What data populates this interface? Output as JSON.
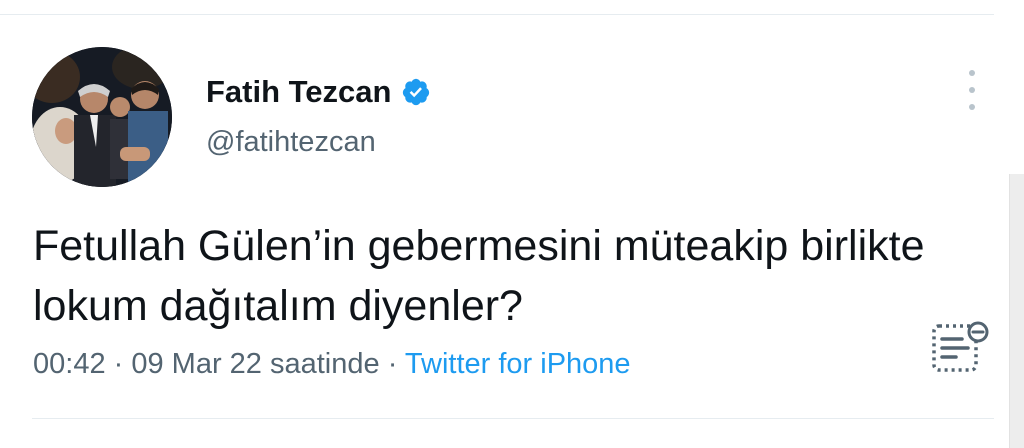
{
  "tweet": {
    "author_name": "Fatih Tezcan",
    "handle": "@fatihtezcan",
    "verified": true,
    "text": "Fetullah Gülen’in gebermesini müteakip birlikte lokum dağıtalım diyenler?",
    "time": "00:42",
    "date_text": "09 Mar 22 saatinde",
    "separator": " · ",
    "source": "Twitter for iPhone"
  },
  "icons": {
    "verified": "verified-badge-icon",
    "more": "more-options-icon",
    "analytics": "tweet-analytics-icon"
  },
  "colors": {
    "accent": "#1d9bf0",
    "text_primary": "#0f1419",
    "text_secondary": "#536471"
  }
}
